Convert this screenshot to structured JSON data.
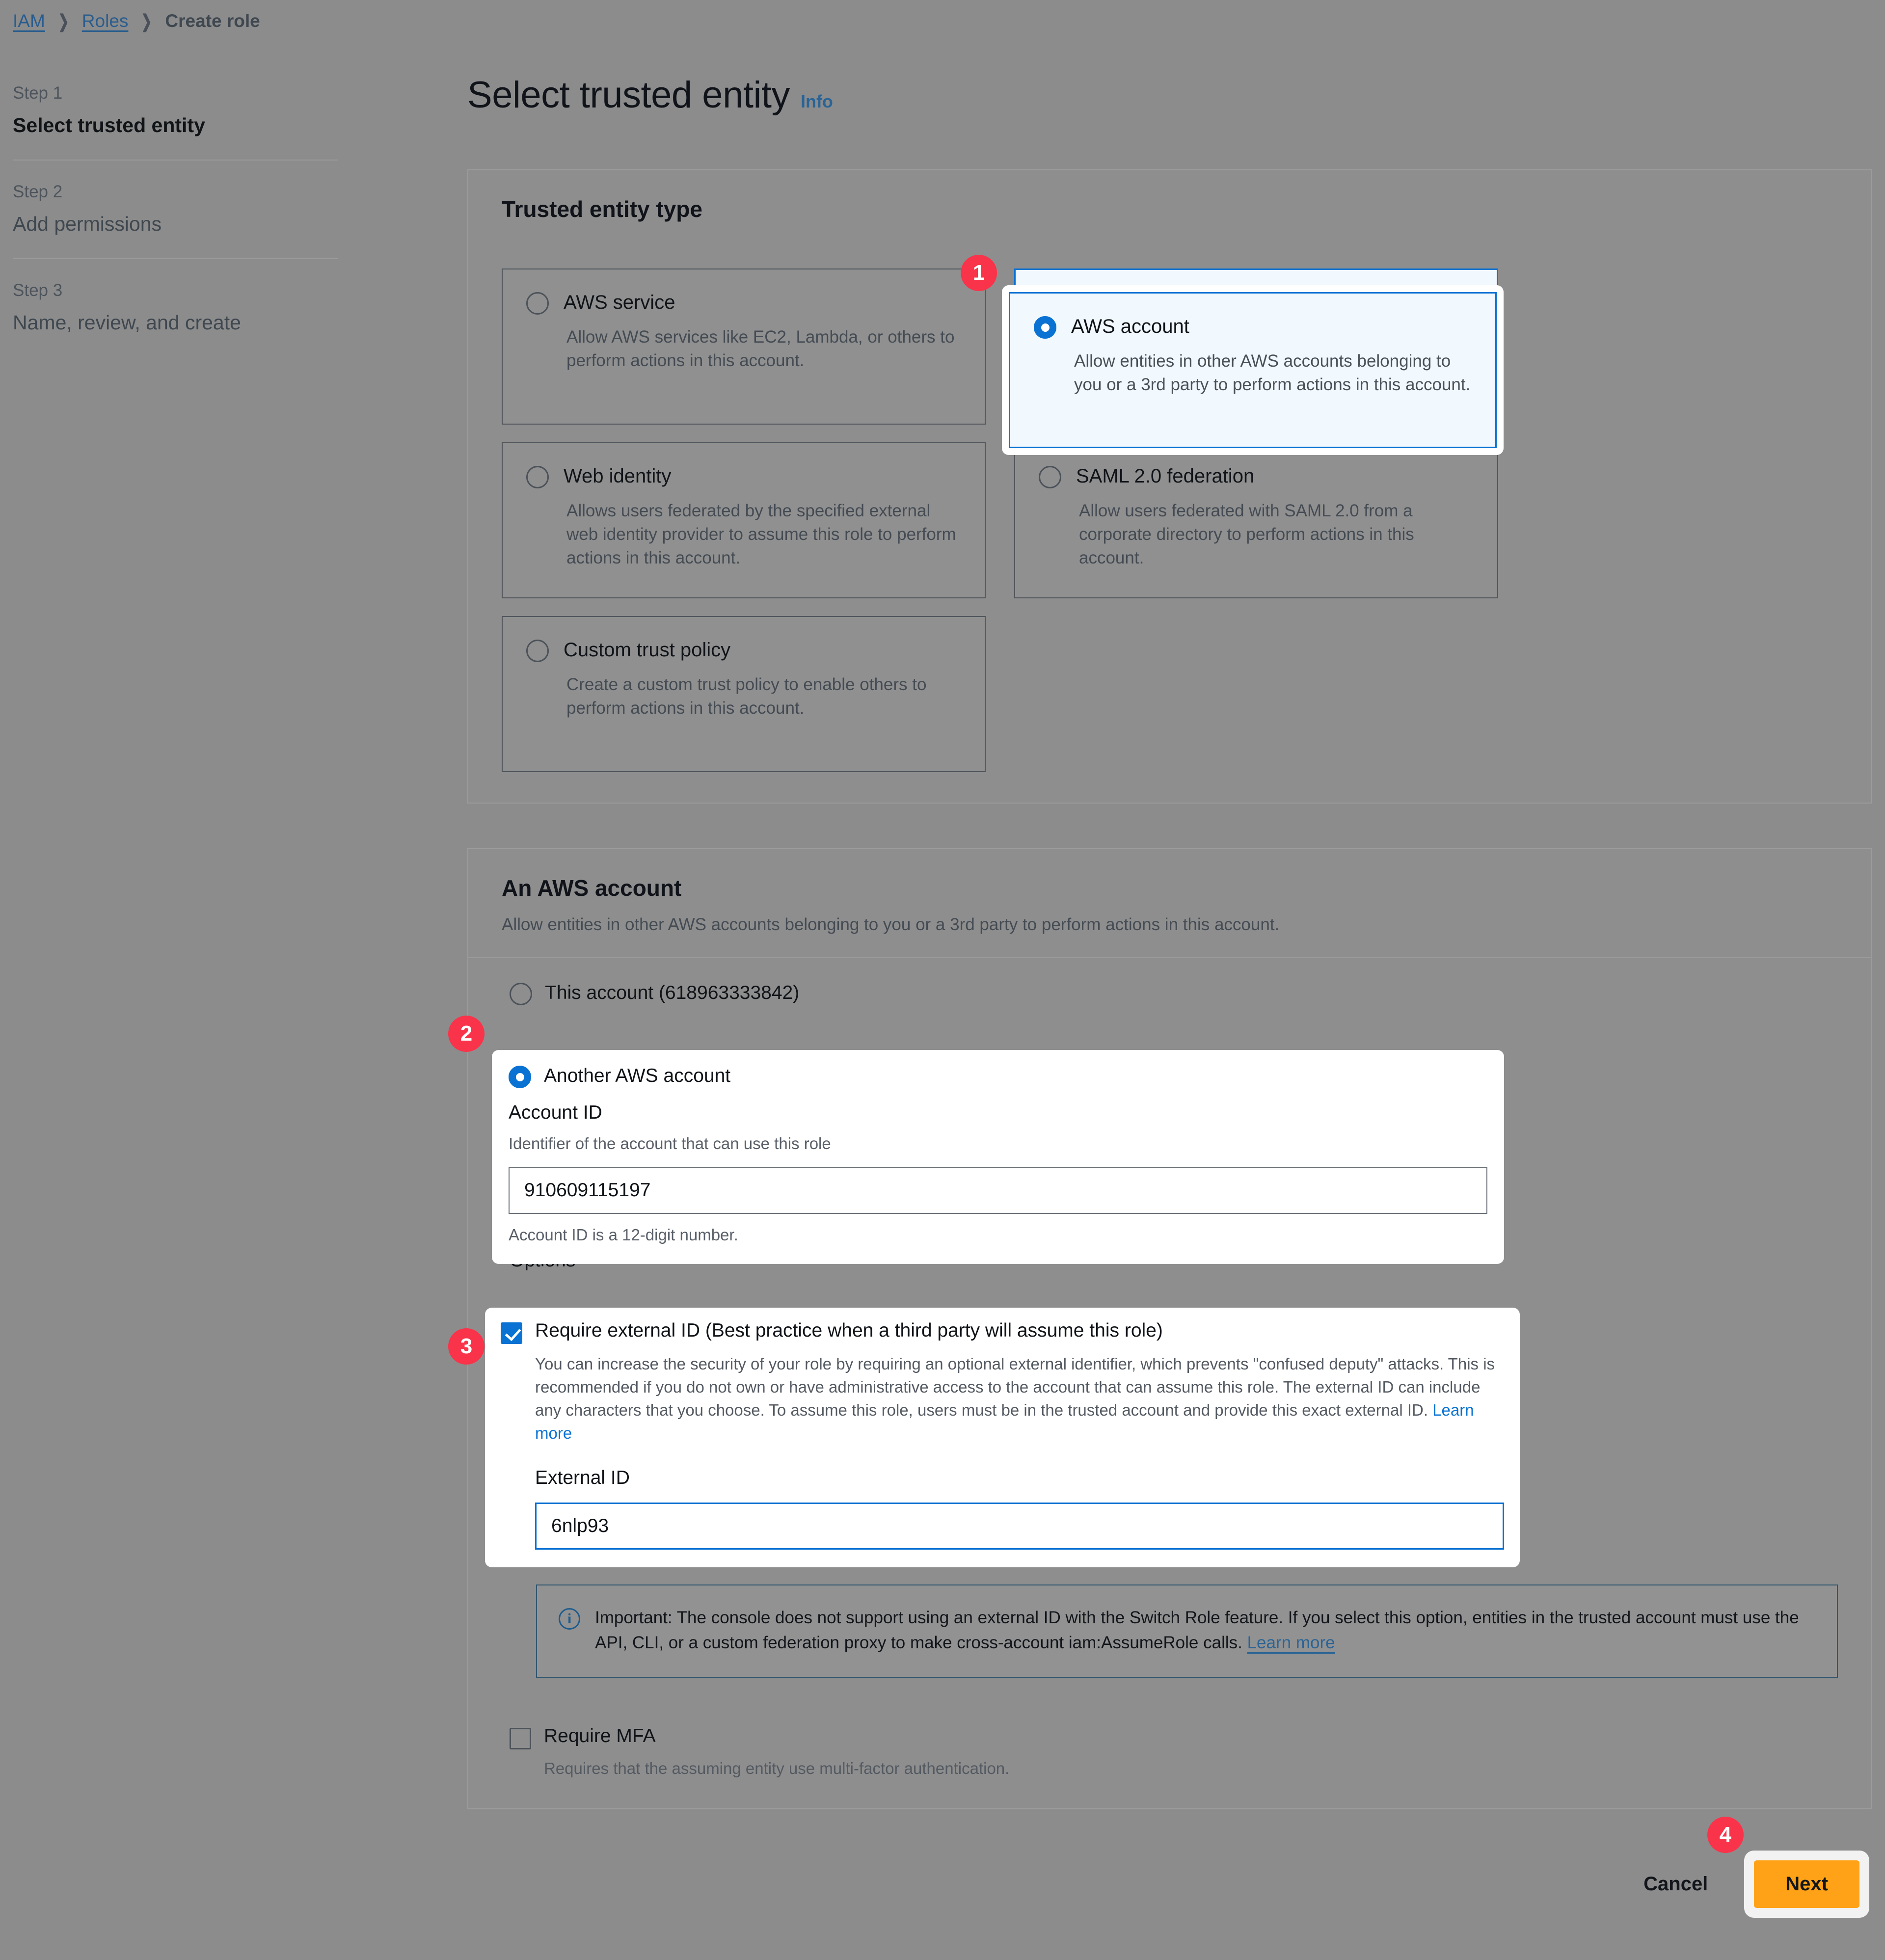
{
  "breadcrumb": {
    "items": [
      {
        "label": "IAM",
        "type": "link"
      },
      {
        "label": "Roles",
        "type": "link"
      },
      {
        "label": "Create role",
        "type": "current"
      }
    ],
    "separator": "❯"
  },
  "steps": [
    {
      "number": "Step 1",
      "title": "Select trusted entity",
      "active": true
    },
    {
      "number": "Step 2",
      "title": "Add permissions",
      "active": false
    },
    {
      "number": "Step 3",
      "title": "Name, review, and create",
      "active": false
    }
  ],
  "header": {
    "title": "Select trusted entity",
    "info_label": "Info"
  },
  "trusted_entity_type": {
    "section_title": "Trusted entity type",
    "tiles": [
      {
        "id": "aws-service",
        "label": "AWS service",
        "description": "Allow AWS services like EC2, Lambda, or others to perform actions in this account.",
        "selected": false
      },
      {
        "id": "aws-account",
        "label": "AWS account",
        "description": "Allow entities in other AWS accounts belonging to you or a 3rd party to perform actions in this account.",
        "selected": true
      },
      {
        "id": "web-identity",
        "label": "Web identity",
        "description": "Allows users federated by the specified external web identity provider to assume this role to perform actions in this account.",
        "selected": false
      },
      {
        "id": "saml-federation",
        "label": "SAML 2.0 federation",
        "description": "Allow users federated with SAML 2.0 from a corporate directory to perform actions in this account.",
        "selected": false
      },
      {
        "id": "custom-trust-policy",
        "label": "Custom trust policy",
        "description": "Create a custom trust policy to enable others to perform actions in this account.",
        "selected": false
      }
    ]
  },
  "an_aws_account": {
    "section_title": "An AWS account",
    "section_description": "Allow entities in other AWS accounts belonging to you or a 3rd party to perform actions in this account.",
    "this_account": {
      "label": "This account (618963333842)",
      "selected": false
    },
    "another_account": {
      "label": "Another AWS account",
      "selected": true,
      "account_id_label": "Account ID",
      "account_id_hint": "Identifier of the account that can use this role",
      "account_id_value": "910609115197",
      "account_id_placeholder": "",
      "account_id_note": "Account ID is a 12-digit number."
    },
    "options": {
      "label": "Options",
      "external_id": {
        "checkbox_label": "Require external ID (Best practice when a third party will assume this role)",
        "checked": true,
        "description_part1": "You can increase the security of your role by requiring an optional external identifier, which prevents \"confused deputy\" attacks. This is recommended if you do not own or have administrative access to the account that can assume this role. The external ID can include any characters that you choose. To assume this role, users must be in the trusted account and provide this exact external ID. ",
        "learn_more": "Learn more",
        "field_label": "External ID",
        "field_value": "6nlp93",
        "field_placeholder": ""
      },
      "alert": {
        "icon": "info-icon",
        "text_part1": "Important: The console does not support using an external ID with the Switch Role feature. If you select this option, entities in the trusted account must use the API, CLI, or a custom federation proxy to make cross-account iam:AssumeRole calls. ",
        "learn_more": "Learn more"
      },
      "mfa": {
        "checkbox_label": "Require MFA",
        "checked": false,
        "description": "Requires that the assuming entity use multi-factor authentication."
      }
    }
  },
  "footer": {
    "cancel_label": "Cancel",
    "next_label": "Next"
  },
  "annotation_badges": [
    {
      "number": "1",
      "target": "aws-account-tile"
    },
    {
      "number": "2",
      "target": "another-aws-account-option"
    },
    {
      "number": "3",
      "target": "require-external-id-option"
    },
    {
      "number": "4",
      "target": "next-button"
    }
  ],
  "colors": {
    "accent_blue": "#0972d3",
    "link_blue": "#2a6496",
    "badge_red": "#f8334a",
    "next_orange": "#ffa217",
    "page_bg": "#8c8c8c"
  }
}
